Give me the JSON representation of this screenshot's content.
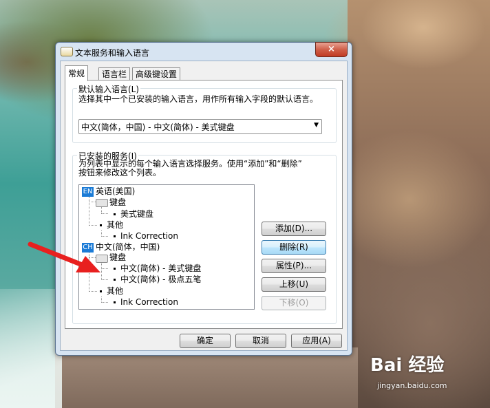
{
  "window": {
    "title": "文本服务和输入语言",
    "close_label": "×"
  },
  "tabs": [
    {
      "label": "常规",
      "active": true
    },
    {
      "label": "语言栏",
      "active": false
    },
    {
      "label": "高级键设置",
      "active": false
    }
  ],
  "default_language": {
    "group_title": "默认输入语言(L)",
    "description": "选择其中一个已安装的输入语言，用作所有输入字段的默认语言。",
    "selected": "中文(简体，中国) - 中文(简体) - 美式键盘"
  },
  "installed_services": {
    "group_title": "已安装的服务(I)",
    "description_line1": "为列表中显示的每个输入语言选择服务。使用“添加”和“删除”",
    "description_line2": "按钮来修改这个列表。",
    "tree": {
      "lang1": {
        "icon": "EN",
        "label": "英语(美国)"
      },
      "lang1_keyboard": "键盘",
      "lang1_keyboard_item": "美式键盘",
      "lang1_other": "其他",
      "lang1_other_item": "Ink Correction",
      "lang2": {
        "icon": "CH",
        "label": "中文(简体，中国)"
      },
      "lang2_keyboard": "键盘",
      "lang2_keyboard_item1": "中文(简体) - 美式键盘",
      "lang2_keyboard_item2": "中文(简体) - 极点五笔",
      "lang2_other": "其他",
      "lang2_other_item": "Ink Correction"
    },
    "buttons": {
      "add": "添加(D)...",
      "remove": "删除(R)",
      "properties": "属性(P)...",
      "move_up": "上移(U)",
      "move_down": "下移(O)"
    }
  },
  "footer": {
    "ok": "确定",
    "cancel": "取消",
    "apply": "应用(A)"
  },
  "watermark": {
    "logo": "Bai 经验",
    "url": "jingyan.baidu.com"
  },
  "colors": {
    "annotation_arrow": "#e8201f",
    "language_icon": "#1b7bd6"
  }
}
